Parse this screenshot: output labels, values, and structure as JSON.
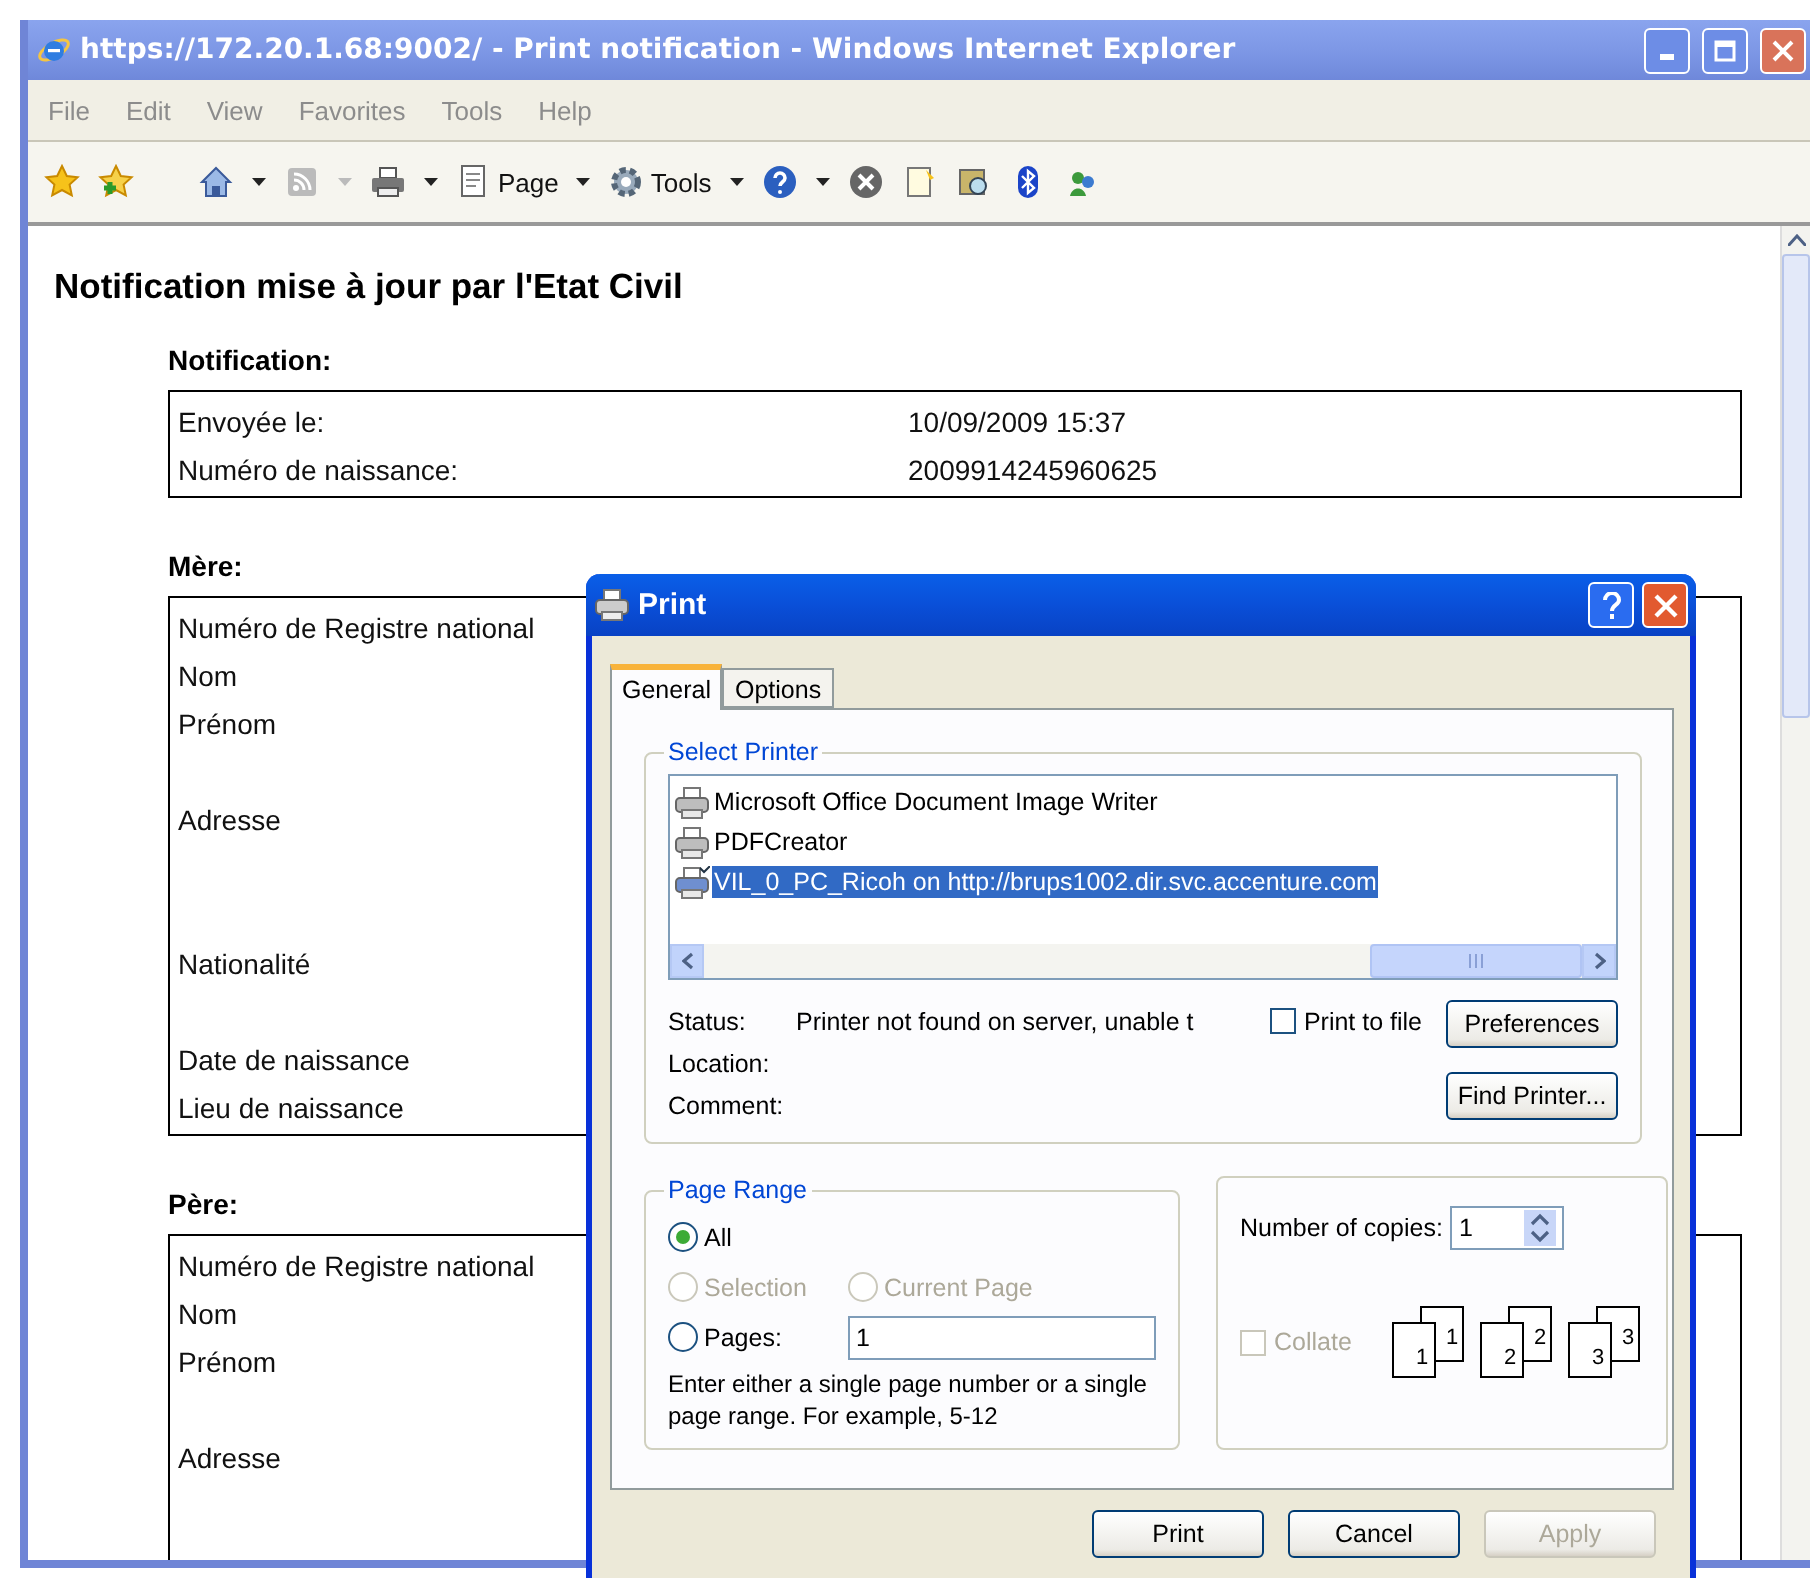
{
  "browser": {
    "title": "https://172.20.1.68:9002/ - Print notification - Windows Internet Explorer",
    "menu": [
      "File",
      "Edit",
      "View",
      "Favorites",
      "Tools",
      "Help"
    ],
    "toolbar_labels": [
      "Page",
      "Tools"
    ]
  },
  "page": {
    "heading": "Notification mise à jour par l'Etat Civil",
    "sections": [
      {
        "title": "Notification:",
        "rows": [
          {
            "label": "Envoyée le:",
            "value": "10/09/2009 15:37",
            "kind": "single"
          },
          {
            "label": "Numéro de naissance:",
            "value": "2009914245960625",
            "kind": "single"
          }
        ]
      },
      {
        "title": "Mère:",
        "rows": [
          {
            "label": "Numéro de Registre national",
            "kind": "single"
          },
          {
            "label": "Nom",
            "kind": "single"
          },
          {
            "label": "Prénom",
            "kind": "double"
          },
          {
            "label": "Adresse",
            "kind": "triple"
          },
          {
            "label": "Nationalité",
            "kind": "double"
          },
          {
            "label": "Date de naissance",
            "kind": "single"
          },
          {
            "label": "Lieu de naissance",
            "kind": "single"
          }
        ]
      },
      {
        "title": "Père:",
        "rows": [
          {
            "label": "Numéro de Registre national",
            "kind": "single"
          },
          {
            "label": "Nom",
            "kind": "single"
          },
          {
            "label": "Prénom",
            "kind": "double"
          },
          {
            "label": "Adresse",
            "kind": "triple"
          }
        ]
      }
    ]
  },
  "dialog": {
    "title": "Print",
    "tabs": [
      {
        "label": "General",
        "selected": true
      },
      {
        "label": "Options",
        "selected": false
      }
    ],
    "select_printer": {
      "title": "Select Printer",
      "printers": [
        {
          "name": "Microsoft Office Document Image Writer",
          "selected": false,
          "kind": "local"
        },
        {
          "name": "PDFCreator",
          "selected": false,
          "kind": "local"
        },
        {
          "name": "VIL_0_PC_Ricoh on http://brups1002.dir.svc.accenture.com",
          "selected": true,
          "kind": "network"
        }
      ],
      "info": [
        {
          "label": "Status:",
          "value": "Printer not found on server, unable t"
        },
        {
          "label": "Location:"
        },
        {
          "label": "Comment:"
        }
      ],
      "print_to_file": {
        "label": "Print to file",
        "checked": false
      },
      "buttons": [
        "Preferences",
        "Find Printer..."
      ]
    },
    "page_range": {
      "title": "Page Range",
      "options": [
        {
          "label": "All",
          "selected": true,
          "disabled": false
        },
        {
          "label": "Selection",
          "selected": false,
          "disabled": true
        },
        {
          "label": "Current Page",
          "selected": false,
          "disabled": true
        },
        {
          "label": "Pages:",
          "selected": false,
          "disabled": false
        }
      ],
      "pages_value": "1",
      "hint": "Enter either a single page number or a single page range.  For example, 5-12"
    },
    "copies": {
      "label": "Number of copies:",
      "value": "1",
      "collate": {
        "label": "Collate",
        "checked": false,
        "disabled": true
      },
      "stacks": [
        {
          "front": "1",
          "back": "1"
        },
        {
          "front": "2",
          "back": "2"
        },
        {
          "front": "3",
          "back": "3"
        }
      ]
    },
    "buttons": [
      {
        "label": "Print",
        "disabled": false
      },
      {
        "label": "Cancel",
        "disabled": false
      },
      {
        "label": "Apply",
        "disabled": true
      }
    ]
  }
}
